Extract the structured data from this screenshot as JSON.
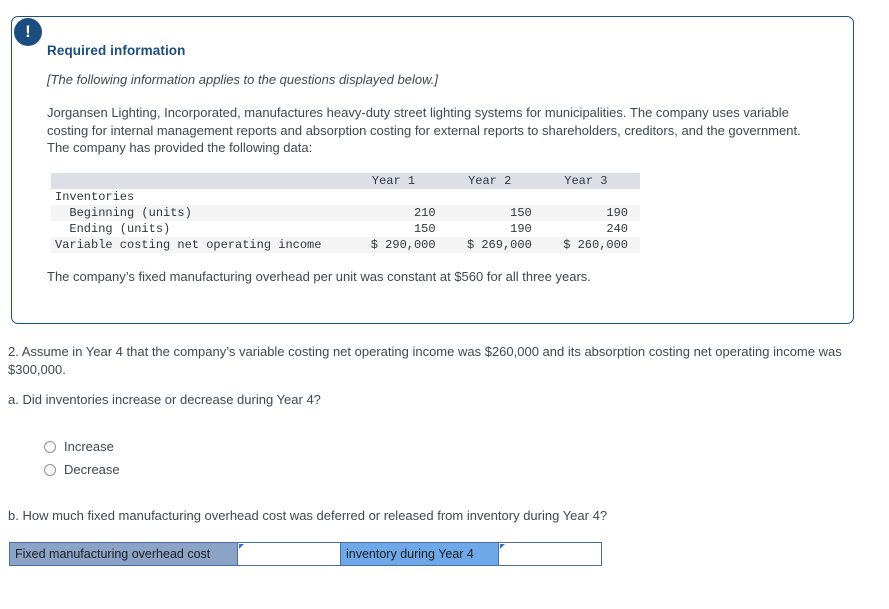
{
  "alert": {
    "icon": "exclamation-icon",
    "glyph": "!"
  },
  "required_info": {
    "heading": "Required information",
    "applies_note": "[The following information applies to the questions displayed below.]",
    "paragraph": "Jorgansen Lighting, Incorporated, manufactures heavy-duty street lighting systems for municipalities. The company uses variable costing for internal management reports and absorption costing for external reports to shareholders, creditors, and the government. The company has provided the following data:",
    "fixed_overhead_note": "The company’s fixed manufacturing overhead per unit was constant at $560 for all three years."
  },
  "table": {
    "columns": [
      "",
      "Year 1",
      "Year 2",
      "Year 3"
    ],
    "rows": [
      {
        "label": "Inventories",
        "values": [
          "",
          "",
          ""
        ],
        "shade": false
      },
      {
        "label": "  Beginning (units)",
        "values": [
          "210",
          "150",
          "190"
        ],
        "shade": true
      },
      {
        "label": "  Ending (units)",
        "values": [
          "150",
          "190",
          "240"
        ],
        "shade": false
      },
      {
        "label": "Variable costing net operating income",
        "values": [
          "$ 290,000",
          "$ 269,000",
          "$ 260,000"
        ],
        "shade": true
      }
    ]
  },
  "questions": {
    "q2": "2. Assume in Year 4 that the company’s variable costing net operating income was $260,000 and its absorption costing net operating income was $300,000.",
    "qa": "a. Did inventories increase or decrease during Year 4?",
    "qb": "b. How much fixed manufacturing overhead cost was deferred or released from inventory during Year 4?"
  },
  "radio_options": [
    {
      "label": "Increase",
      "selected": false
    },
    {
      "label": "Decrease",
      "selected": false
    }
  ],
  "answer_row": {
    "label_a": "Fixed manufacturing overhead cost",
    "input_a": "",
    "label_b": "inventory during Year 4",
    "input_b": ""
  },
  "colors": {
    "card_border": "#1b4f87",
    "heading_blue": "#1c4d80",
    "badge_navy": "#1c4d80",
    "table_header_bg": "#dcdfe6",
    "table_shade_bg": "#f4f4f5",
    "answer_label_a_bg": "#8ba3c7",
    "answer_label_b_bg": "#6fa8e8",
    "answer_border": "#4a6f9e",
    "body_text": "#3d4852"
  }
}
